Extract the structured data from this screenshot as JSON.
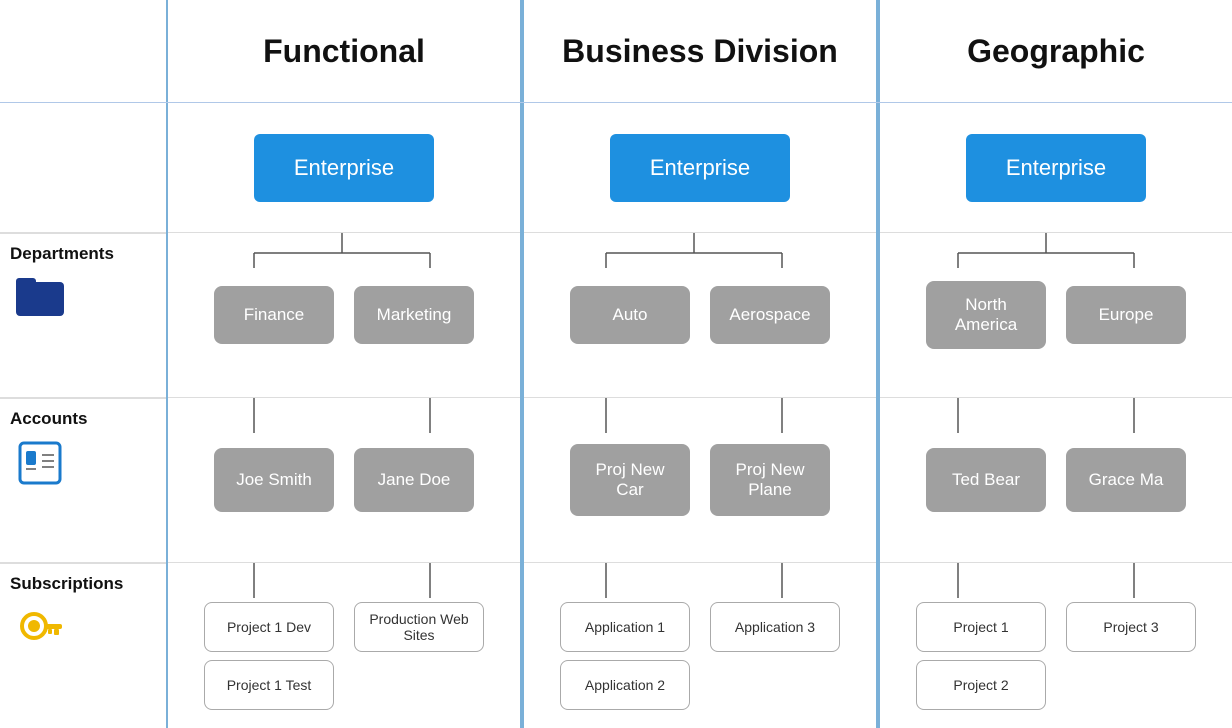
{
  "headers": {
    "functional": "Functional",
    "business": "Business Division",
    "geographic": "Geographic"
  },
  "labels": {
    "departments": "Departments",
    "accounts": "Accounts",
    "subscriptions": "Subscriptions"
  },
  "columns": {
    "functional": {
      "enterprise": "Enterprise",
      "departments": [
        "Finance",
        "Marketing"
      ],
      "accounts": [
        "Joe Smith",
        "Jane Doe"
      ],
      "subscriptions_left": [
        "Project 1 Dev",
        "Project 1 Test"
      ],
      "subscriptions_right": [
        "Production Web Sites"
      ]
    },
    "business": {
      "enterprise": "Enterprise",
      "departments": [
        "Auto",
        "Aerospace"
      ],
      "accounts_left": [
        "Proj New Car"
      ],
      "accounts_right": [
        "Proj New Plane"
      ],
      "subscriptions_left": [
        "Application 1",
        "Application 2"
      ],
      "subscriptions_right": [
        "Application 3"
      ]
    },
    "geographic": {
      "enterprise": "Enterprise",
      "departments": [
        "North America",
        "Europe"
      ],
      "accounts": [
        "Ted Bear",
        "Grace Ma"
      ],
      "subscriptions_left": [
        "Project 1",
        "Project 2"
      ],
      "subscriptions_right": [
        "Project 3"
      ]
    }
  },
  "colors": {
    "blue_node": "#1e90e0",
    "gray_node": "#a0a0a0",
    "border_col": "#7ab0d8",
    "connector": "#555555",
    "folder_icon": "#1a3a8c",
    "account_icon": "#1a7acc",
    "key_icon": "#f0b800"
  }
}
